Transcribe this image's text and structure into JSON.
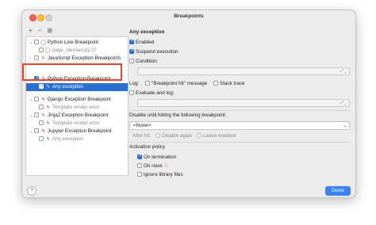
{
  "window": {
    "title": "Breakpoints"
  },
  "toolbar": {
    "add": "+",
    "remove": "−",
    "group": "⊞"
  },
  "tree": {
    "items": [
      {
        "label": "Python Line Breakpoint",
        "indent": 0,
        "kind": "group",
        "checked": false
      },
      {
        "label": "page_element.py:27",
        "indent": 1,
        "kind": "dot",
        "checked": false,
        "muted": true
      },
      {
        "label": "JavaScript Exception Breakpoints",
        "indent": 0,
        "kind": "bolt",
        "checked": false
      },
      {
        "label": "Python Exception Breakpoint",
        "indent": 0,
        "kind": "bolt",
        "checked": true
      },
      {
        "label": "Any exception",
        "indent": 1,
        "kind": "bolt",
        "checked": true,
        "selected": true
      },
      {
        "label": "Django Exception Breakpoint",
        "indent": 0,
        "kind": "bolt",
        "checked": false
      },
      {
        "label": "Template render error",
        "indent": 1,
        "kind": "bolt",
        "checked": false,
        "muted": true
      },
      {
        "label": "Jinja2 Exception Breakpoint",
        "indent": 0,
        "kind": "bolt",
        "checked": false
      },
      {
        "label": "Template render error",
        "indent": 1,
        "kind": "bolt",
        "checked": false,
        "muted": true
      },
      {
        "label": "Jupyter Exception Breakpoint",
        "indent": 0,
        "kind": "bolt",
        "checked": false
      },
      {
        "label": "Any exception",
        "indent": 1,
        "kind": "bolt",
        "checked": false,
        "muted": true
      }
    ]
  },
  "details": {
    "heading": "Any exception",
    "enabled": "Enabled",
    "suspend": "Suspend execution",
    "condition": "Condition:",
    "log_label": "Log:",
    "log_breakpoint_hit": "\"Breakpoint hit\" message",
    "log_stack_trace": "Stack trace",
    "evaluate_and_log": "Evaluate and log:",
    "disable_until": "Disable until hitting the following breakpoint:",
    "disable_select": "<None>",
    "after_hit": "After hit:",
    "disable_again": "Disable again",
    "leave_enabled": "Leave enabled",
    "activation_policy": "Activation policy",
    "on_termination": "On termination",
    "on_raise": "On raise",
    "ignore_library": "Ignore library files"
  },
  "footer": {
    "help": "?",
    "done": "Done"
  },
  "colors": {
    "accent": "#2b6fd1",
    "highlight": "#e0442b",
    "done": "#3b82f6"
  }
}
